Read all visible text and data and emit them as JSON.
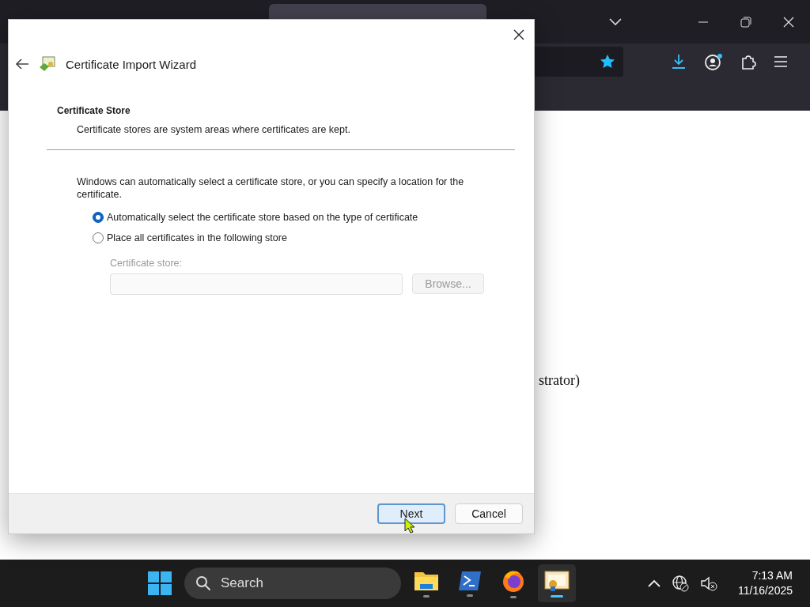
{
  "browser": {
    "page_text": "strator)"
  },
  "dialog": {
    "title": "Certificate Import Wizard",
    "heading": "Certificate Store",
    "subheading": "Certificate stores are system areas where certificates are kept.",
    "description": "Windows can automatically select a certificate store, or you can specify a location for the certificate.",
    "options": [
      {
        "label": "Automatically select the certificate store based on the type of certificate",
        "selected": true
      },
      {
        "label": "Place all certificates in the following store",
        "selected": false
      }
    ],
    "store_label": "Certificate store:",
    "store_field": {
      "disabled": true
    },
    "browse_button": {
      "label": "Browse...",
      "disabled": true
    },
    "buttons": [
      {
        "label": "Next",
        "default": true
      },
      {
        "label": "Cancel",
        "default": false
      }
    ]
  },
  "taskbar": {
    "search": {
      "placeholder": "Search"
    },
    "apps": [
      {
        "kind": "folder",
        "active": false
      },
      {
        "kind": "terminal",
        "active": false
      },
      {
        "kind": "firefox",
        "active": false
      },
      {
        "kind": "certificate",
        "active": true
      }
    ],
    "time": "7:13 AM",
    "date": "11/16/2025"
  }
}
